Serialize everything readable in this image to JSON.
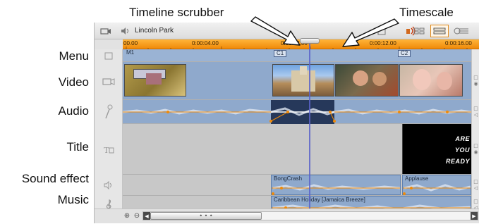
{
  "callouts": {
    "timeline_scrubber": "Timeline scrubber",
    "timescale": "Timescale"
  },
  "row_labels": {
    "menu": "Menu",
    "video": "Video",
    "audio": "Audio",
    "title": "Title",
    "sound_effect": "Sound effect",
    "music": "Music"
  },
  "toolbar": {
    "project_name": "Lincoln Park"
  },
  "ruler": {
    "ticks": [
      "00.00",
      "0:00:04.00",
      "0:00:08.00",
      "0:00:12.00",
      "0:00:16.00"
    ]
  },
  "menu_track": {
    "chapters": [
      "M1",
      "C1",
      "C2"
    ]
  },
  "title_track": {
    "lines": [
      "ARE",
      "YOU",
      "READY"
    ]
  },
  "sound_effect_track": {
    "clips": [
      "BongCrash",
      "Applause"
    ]
  },
  "music_track": {
    "clips": [
      "Caribbean Holiday [Jamaica Breeze]"
    ]
  },
  "scrollbar": {
    "grip": "• • •"
  },
  "colors": {
    "ruler": "#f49a1a",
    "clip_blue": "#8aa8cf",
    "playhead": "#5b63c9",
    "active_view": "#e08a1c"
  }
}
